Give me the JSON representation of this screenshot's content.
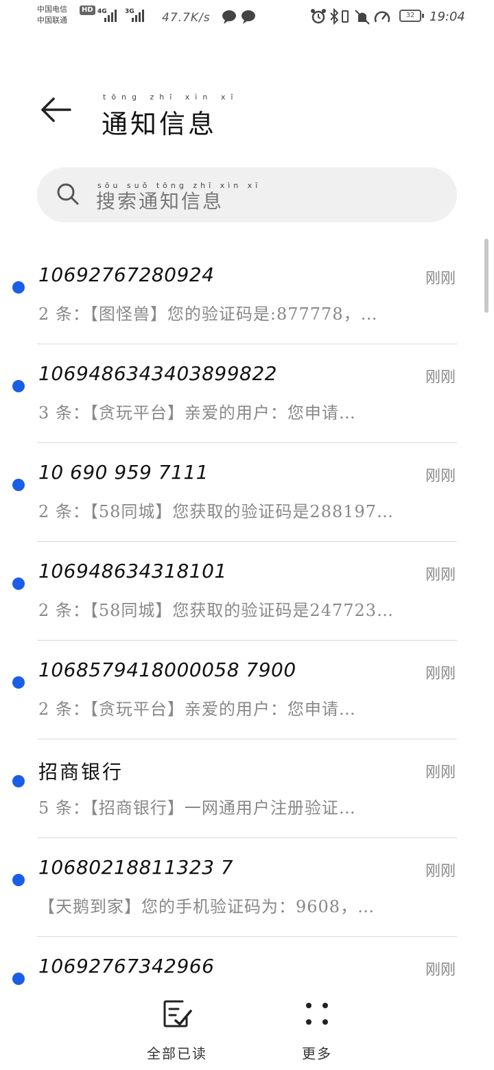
{
  "status_bar": {
    "carrier_1": "中国电信",
    "carrier_2": "中国联通",
    "hd": "HD",
    "sig1_label": "4G",
    "sig2_label": "3G",
    "net_speed": "47.7K/s",
    "battery": "32",
    "time": "19:04"
  },
  "header": {
    "title": "通知信息",
    "title_pinyin": "tōng zhī xìn xī"
  },
  "search": {
    "placeholder": "搜索通知信息",
    "placeholder_pinyin": "sōu suǒ tōng zhī xìn xī"
  },
  "messages": [
    {
      "sender": "10692767280924",
      "time": "刚刚",
      "preview": "2 条：【图怪兽】您的验证码是:877778，…"
    },
    {
      "sender": "1069486343403899822",
      "time": "刚刚",
      "preview": "3 条：【贪玩平台】亲爱的用户：您申请…"
    },
    {
      "sender": "10 690 959 7111",
      "time": "刚刚",
      "preview": "2 条：【58同城】您获取的验证码是288197…"
    },
    {
      "sender": "106948634318101",
      "time": "刚刚",
      "preview": "2 条：【58同城】您获取的验证码是247723…"
    },
    {
      "sender": "1068579418000058 7900",
      "time": "刚刚",
      "preview": "2 条：【贪玩平台】亲爱的用户：您申请…"
    },
    {
      "sender": "招商银行",
      "time": "刚刚",
      "preview": "5 条：【招商银行】一网通用户注册验证…"
    },
    {
      "sender": "10680218811323 7",
      "time": "刚刚",
      "preview": "【天鹅到家】您的手机验证码为：9608，…"
    },
    {
      "sender": "10692767342966",
      "time": "刚刚",
      "preview": ""
    }
  ],
  "bottom_bar": {
    "mark_all_read": "全部已读",
    "more": "更多"
  }
}
